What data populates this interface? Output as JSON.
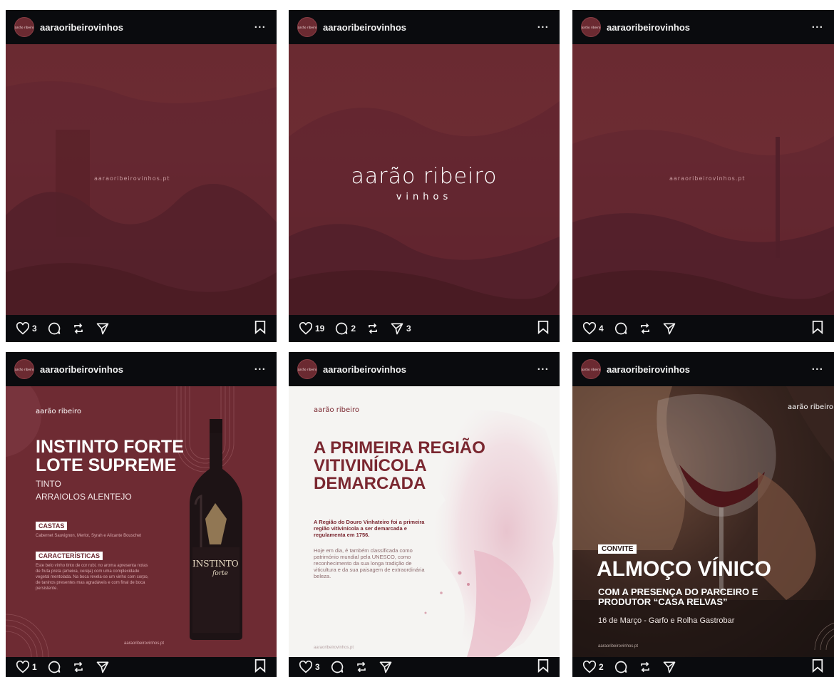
{
  "username": "aaraoribeirovinhos",
  "avatar_text": "aarão ribeiro",
  "more_label": "···",
  "posts": [
    {
      "likes": "3",
      "comments": "",
      "shares": "",
      "url_text": "aaraoribeirovinhos.pt"
    },
    {
      "likes": "19",
      "comments": "2",
      "shares": "3",
      "logo_name": "aarão ribeiro",
      "logo_sub": "vinhos"
    },
    {
      "likes": "4",
      "comments": "",
      "shares": "",
      "url_text": "aaraoribeirovinhos.pt"
    },
    {
      "likes": "1",
      "comments": "",
      "shares": "",
      "brand": "aarão ribeiro",
      "title_line1": "INSTINTO FORTE",
      "title_line2": "LOTE SUPREME",
      "sub1": "TINTO",
      "sub2": "ARRAIOLOS  ALENTEJO",
      "tag1": "CASTAS",
      "castas_text": "Cabernet Sauvignon, Merlot, Syrah e Alicante Bouschet",
      "tag2": "CARACTERÍSTICAS",
      "caract_text": "Este belo vinho tinto de cor rubi, no aroma apresenta notas de fruta preta (ameixa, cereja) com uma complexidade vegetal mentolada. Na boca revela-se um vinho com corpo, de taninos presentes mas agradáveis e com final de boca persistente.",
      "bottle_label": "INSTINTO",
      "bottle_sub": "forte",
      "site": "aaraoribeirovinhos.pt"
    },
    {
      "likes": "3",
      "comments": "",
      "shares": "",
      "brand": "aarão ribeiro",
      "title": "A PRIMEIRA REGIÃO VITIVINÍCOLA DEMARCADA",
      "lead": "A Região do Douro Vinhateiro foi a primeira região vitivinícola a ser demarcada e regulamenta em 1756.",
      "body": "Hoje em dia, é também classificada como património mundial pela UNESCO, como reconhecimento da sua longa tradição de viticultura e da sua paisagem de extraordinária beleza.",
      "site": "aaraoribeirovinhos.pt"
    },
    {
      "likes": "2",
      "comments": "",
      "shares": "",
      "brand": "aarão ribeiro",
      "tag": "CONVITE",
      "title": "ALMOÇO VÍNICO",
      "sub": "COM A PRESENÇA DO PARCEIRO E PRODUTOR “CASA RELVAS”",
      "date": "16 de Março - Garfo e Rolha Gastrobar",
      "site": "aaraoribeirovinhos.pt"
    }
  ]
}
